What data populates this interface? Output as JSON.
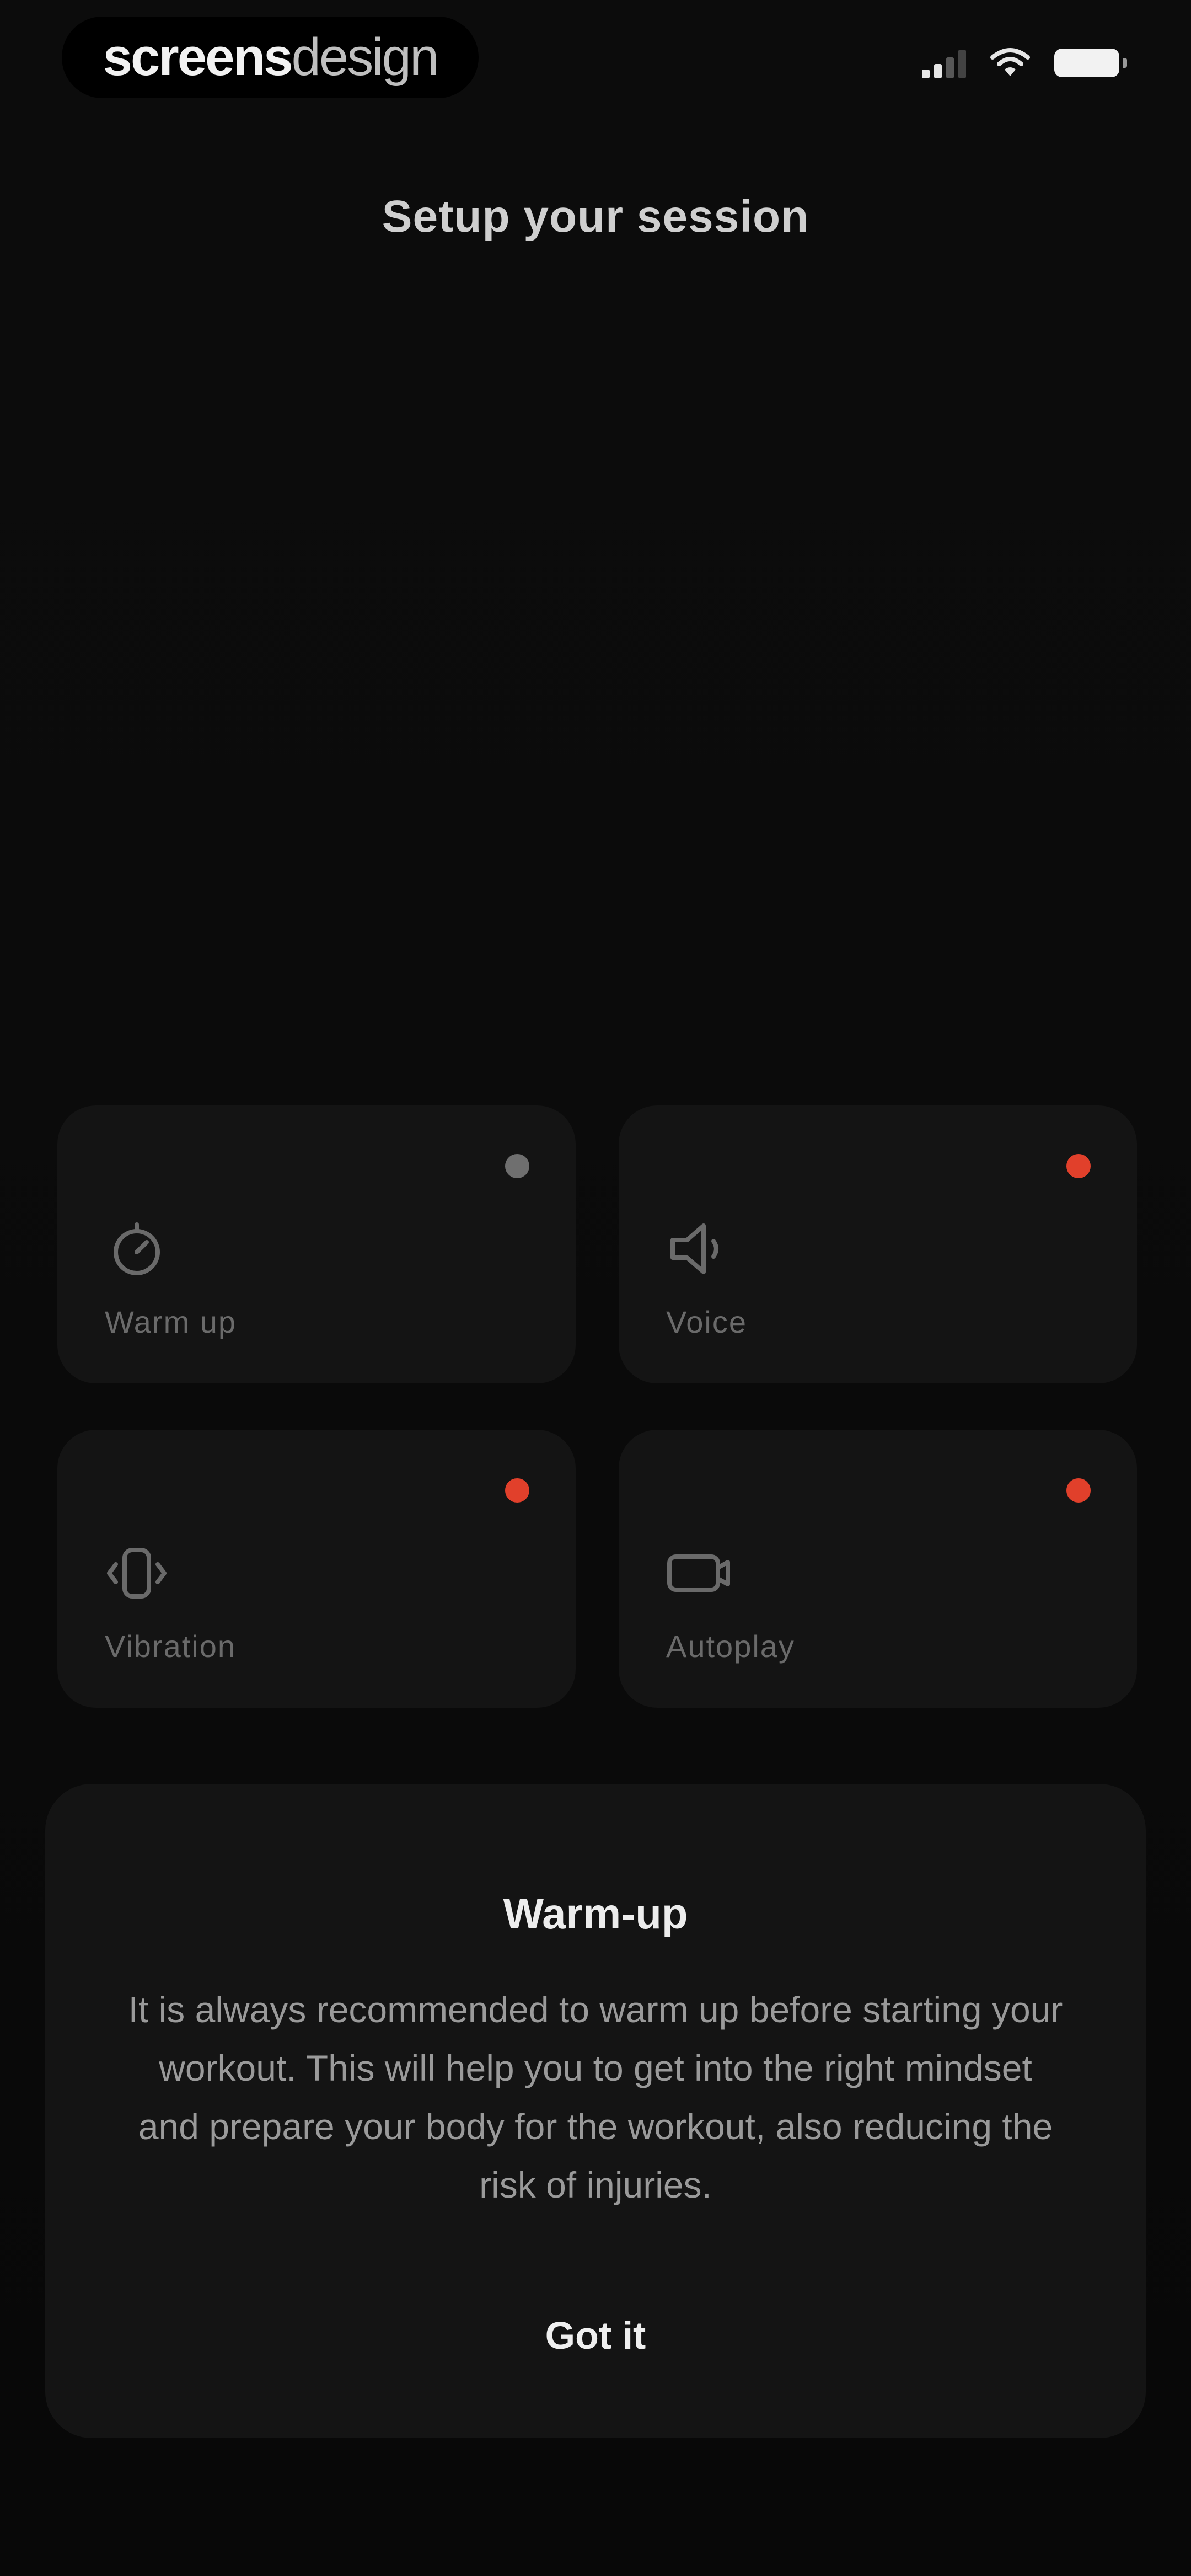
{
  "status_bar": {
    "brand_strong": "screens",
    "brand_light": "design",
    "signal_icon": "cellular-signal-icon",
    "wifi_icon": "wifi-icon",
    "battery_icon": "battery-icon"
  },
  "header": {
    "title": "Setup your session"
  },
  "options": [
    {
      "label": "Warm up",
      "icon": "timer-icon",
      "indicator_color": "#6f6f6f"
    },
    {
      "label": "Voice",
      "icon": "speaker-icon",
      "indicator_color": "#e1402b"
    },
    {
      "label": "Vibration",
      "icon": "vibration-icon",
      "indicator_color": "#e1402b"
    },
    {
      "label": "Autoplay",
      "icon": "video-camera-icon",
      "indicator_color": "#e1402b"
    }
  ],
  "sheet": {
    "title": "Warm-up",
    "body": "It is always recommended to warm up before starting your workout. This will help you to get into the right mindset and prepare your body for the workout, also reducing the risk of injuries.",
    "button_label": "Got it"
  },
  "colors": {
    "background": "#0b0b0b",
    "tile": "#141414",
    "accent": "#e1402b"
  }
}
